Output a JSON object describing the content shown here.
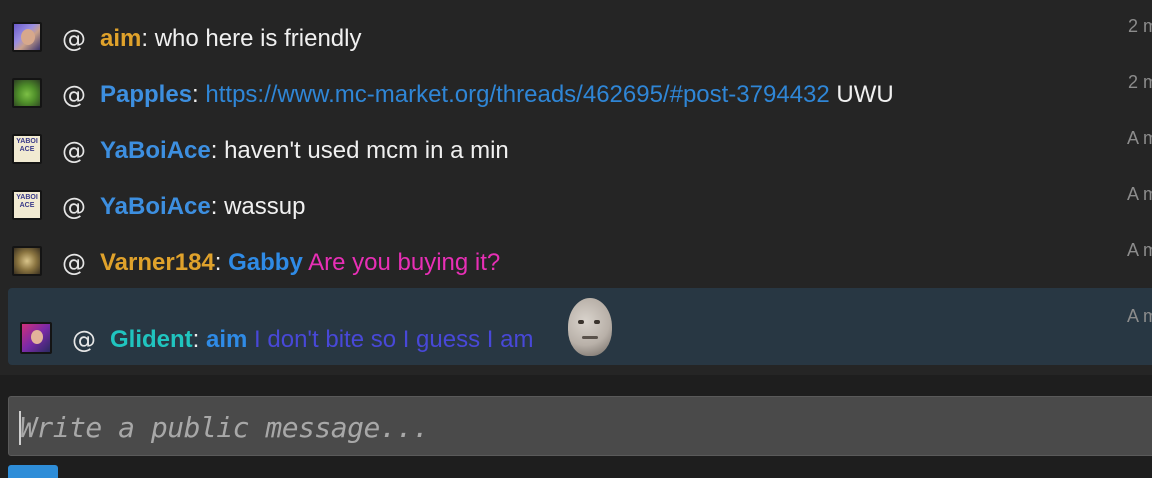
{
  "messages": [
    {
      "at": "@",
      "username": "aim",
      "separator": ": ",
      "parts": [
        {
          "text": "who here is friendly"
        }
      ],
      "time": "2 m",
      "avatar": "avatar-aim"
    },
    {
      "at": "@",
      "username": "Papples",
      "separator": ": ",
      "parts": [
        {
          "text": "https://www.mc-market.org/threads/462695/#post-3794432"
        },
        {
          "text": " UWU"
        }
      ],
      "time": "2 m",
      "avatar": "avatar-papples"
    },
    {
      "at": "@",
      "username": "YaBoiAce",
      "separator": ": ",
      "parts": [
        {
          "text": "haven't used mcm in a min"
        }
      ],
      "time": "A m",
      "avatar": "avatar-yaboiace",
      "avatar_text": [
        "YABOI",
        "ACE"
      ]
    },
    {
      "at": "@",
      "username": "YaBoiAce",
      "separator": ": ",
      "parts": [
        {
          "text": "wassup"
        }
      ],
      "time": "A m",
      "avatar": "avatar-yaboiace",
      "avatar_text": [
        "YABOI",
        "ACE"
      ]
    },
    {
      "at": "@",
      "username": "Varner184",
      "separator": ": ",
      "parts": [
        {
          "text": "Gabby"
        },
        {
          "text": " Are you buying it?"
        }
      ],
      "time": "A m",
      "avatar": "avatar-varner184"
    },
    {
      "at": "@",
      "username": "Glident",
      "separator": ": ",
      "parts": [
        {
          "text": "aim"
        },
        {
          "text": " I don't bite so I guess I am"
        }
      ],
      "time": "A m",
      "avatar": "avatar-glident",
      "emote": "kappa-emote"
    }
  ],
  "composer": {
    "placeholder": "Write a public message..."
  },
  "colors": {
    "background": "#252525",
    "highlight": "#283743",
    "gold_user": "#e0a22b",
    "blue_user": "#3d8fe0",
    "teal_user": "#20c4bf",
    "link": "#2f86d6",
    "pink_text": "#e82fb6",
    "purple_text": "#4848d8"
  }
}
